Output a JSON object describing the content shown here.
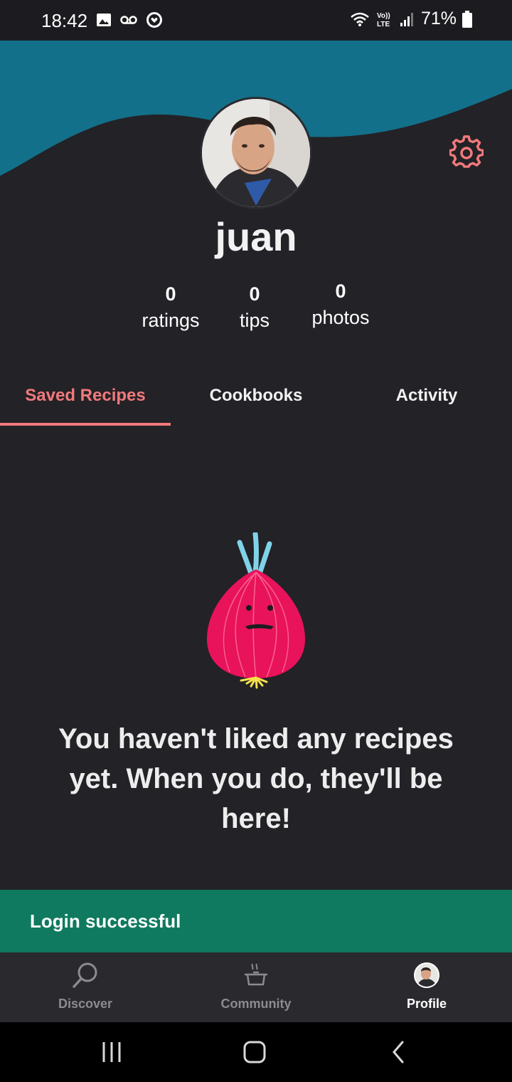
{
  "status_bar": {
    "time": "18:42",
    "battery": "71%"
  },
  "profile": {
    "username": "juan",
    "stats": [
      {
        "value": "0",
        "label": "ratings"
      },
      {
        "value": "0",
        "label": "tips"
      },
      {
        "value": "0",
        "label": "photos"
      }
    ]
  },
  "tabs": [
    {
      "label": "Saved Recipes",
      "active": true
    },
    {
      "label": "Cookbooks",
      "active": false
    },
    {
      "label": "Activity",
      "active": false
    }
  ],
  "empty_state": {
    "message": "You haven't liked any recipes yet. When you do, they'll be here!"
  },
  "toast": {
    "text": "Login successful"
  },
  "bottom_nav": {
    "items": [
      {
        "label": "Discover",
        "icon": "search-icon",
        "active": false
      },
      {
        "label": "Community",
        "icon": "pot-icon",
        "active": false
      },
      {
        "label": "Profile",
        "icon": "avatar-icon",
        "active": true
      }
    ]
  },
  "colors": {
    "background": "#232227",
    "header_wave": "#13708a",
    "accent": "#f2797c",
    "toast": "#0f7a5f",
    "nav_background": "#2a292e"
  }
}
